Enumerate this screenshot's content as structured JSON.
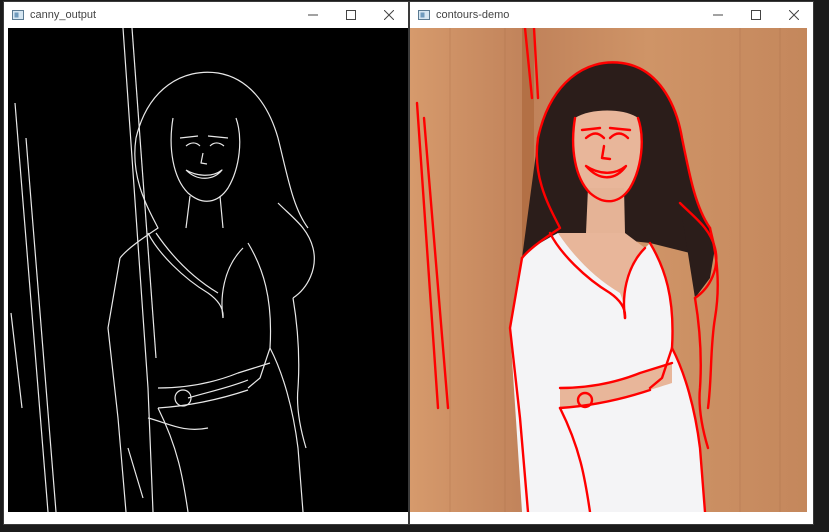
{
  "windows": [
    {
      "title": "canny_output"
    },
    {
      "title": "contours-demo"
    }
  ],
  "captions": {
    "minimize": "minimize",
    "maximize": "maximize",
    "close": "close"
  },
  "colors": {
    "edge": "#e8e8e8",
    "contour": "#ff0000",
    "canny_bg": "#000000",
    "wood": "#c98a5c"
  }
}
